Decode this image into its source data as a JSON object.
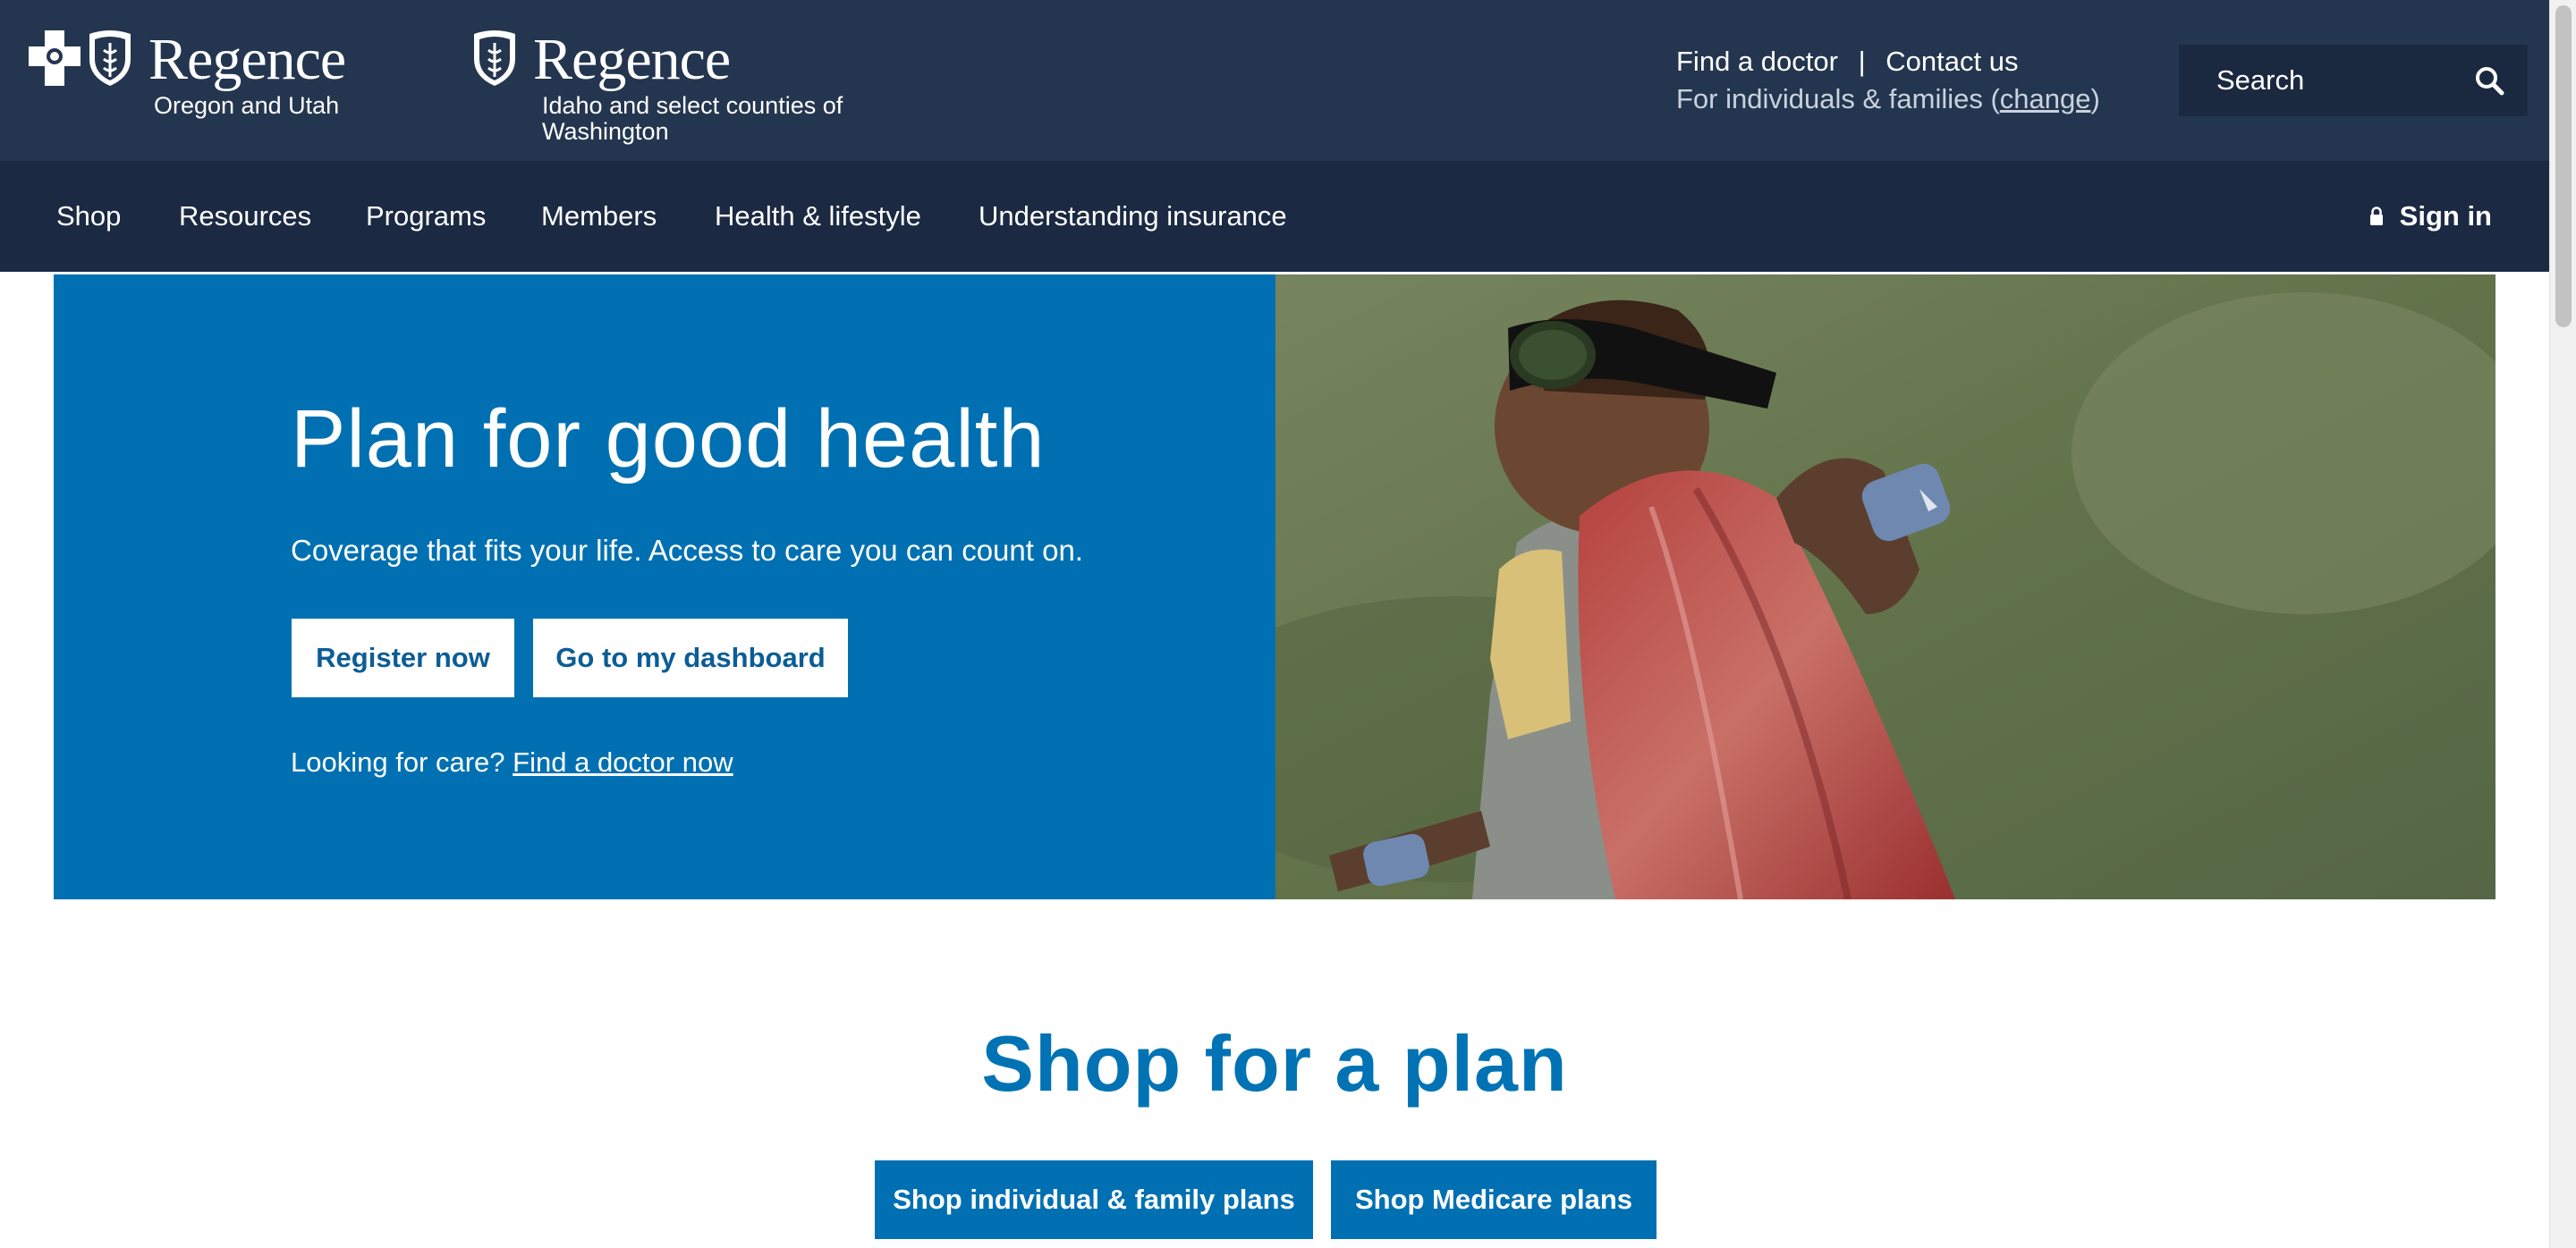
{
  "header": {
    "brand1": {
      "name": "Regence",
      "region": "Oregon and Utah"
    },
    "brand2": {
      "name": "Regence",
      "region": "Idaho and select counties of Washington"
    },
    "util_links": {
      "find_doctor": "Find a doctor",
      "separator": "|",
      "contact": "Contact us"
    },
    "audience": {
      "prefix": "For individuals & families (",
      "change": "change",
      "suffix": ")"
    },
    "search": {
      "placeholder": "Search",
      "icon": "search-icon"
    }
  },
  "nav": {
    "items": [
      "Shop",
      "Resources",
      "Programs",
      "Members",
      "Health & lifestyle",
      "Understanding insurance"
    ],
    "signin": {
      "label": "Sign in",
      "icon": "lock-icon"
    }
  },
  "hero": {
    "title": "Plan for good health",
    "subtitle": "Coverage that fits your life. Access to care you can count on.",
    "register_button": "Register now",
    "dashboard_button": "Go to my dashboard",
    "care_prefix": "Looking for care?",
    "care_link": "Find a doctor now"
  },
  "shop": {
    "title": "Shop for a plan",
    "individual_button": "Shop individual & family plans",
    "medicare_button": "Shop Medicare plans"
  },
  "colors": {
    "header_bg": "#24364f",
    "nav_bg": "#1b2a42",
    "hero_blue": "#0170b2",
    "accent_text": "#0173b4"
  }
}
